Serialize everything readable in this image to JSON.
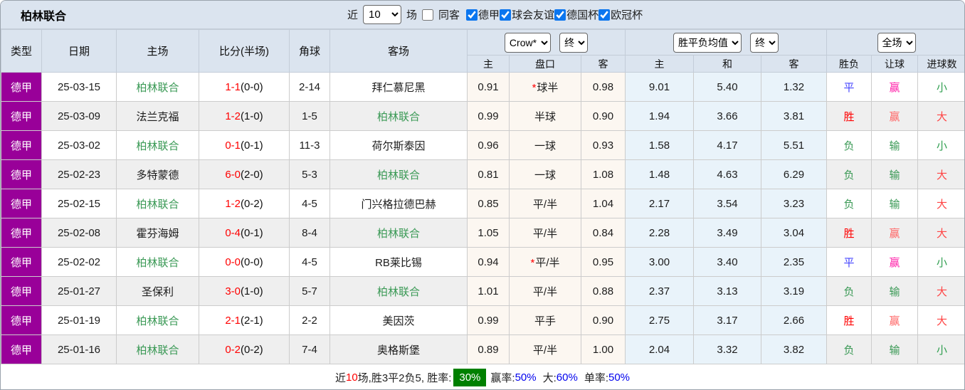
{
  "page": {
    "title": "柏林联合"
  },
  "colors": {
    "header_bg": "#dbe4ef",
    "row_alt_bg": "#efefef",
    "odds_bg": "#fcf7f1",
    "avg_bg": "#e9f3fa",
    "league_badge_bg": "#990099",
    "team_highlight": "#3a9955",
    "score_red": "#ff0000",
    "win": "#ff0000",
    "draw": "#4444ff",
    "lose": "#3a9955",
    "handicap_win": "#ff6666",
    "handicap_win_star": "#ff22aa",
    "handicap_lose": "#3a9955",
    "goals_big": "#ff4444",
    "goals_small": "#2f9e4f",
    "rate_badge_bg": "#008000",
    "percent_blue": "#0000ee",
    "count_red": "#ff0000"
  },
  "controls": {
    "recent_label": "近",
    "games_count": "10",
    "games_label": "场",
    "same_opponent": {
      "label": "同客",
      "checked": false
    },
    "leagues": [
      {
        "label": "德甲",
        "checked": true
      },
      {
        "label": "球会友谊",
        "checked": true
      },
      {
        "label": "德国杯",
        "checked": true
      },
      {
        "label": "欧冠杯",
        "checked": true
      }
    ]
  },
  "table": {
    "selectors": {
      "bookmaker": "Crow*",
      "bookmaker_state": "终",
      "avg_type": "胜平负均值",
      "avg_state": "终",
      "period": "全场"
    },
    "columns": {
      "type": "类型",
      "date": "日期",
      "home": "主场",
      "score": "比分(半场)",
      "corners": "角球",
      "away": "客场",
      "odds_home": "主",
      "odds_line": "盘口",
      "odds_away": "客",
      "avg_home": "主",
      "avg_draw": "和",
      "avg_away": "客",
      "result": "胜负",
      "handicap": "让球",
      "goals": "进球数"
    },
    "rows": [
      {
        "type": "德甲",
        "date": "25-03-15",
        "home": "柏林联合",
        "home_highlight": true,
        "score": "1-1",
        "half": "(0-0)",
        "corners": "2-14",
        "away": "拜仁慕尼黑",
        "away_highlight": false,
        "odds_home": "0.91",
        "line": "球半",
        "line_star": true,
        "odds_away": "0.98",
        "avg_home": "9.01",
        "avg_draw": "5.40",
        "avg_away": "1.32",
        "result": "平",
        "handicap": "赢",
        "goals": "小"
      },
      {
        "type": "德甲",
        "date": "25-03-09",
        "home": "法兰克福",
        "home_highlight": false,
        "score": "1-2",
        "half": "(1-0)",
        "corners": "1-5",
        "away": "柏林联合",
        "away_highlight": true,
        "odds_home": "0.99",
        "line": "半球",
        "line_star": false,
        "odds_away": "0.90",
        "avg_home": "1.94",
        "avg_draw": "3.66",
        "avg_away": "3.81",
        "result": "胜",
        "handicap": "赢",
        "goals": "大"
      },
      {
        "type": "德甲",
        "date": "25-03-02",
        "home": "柏林联合",
        "home_highlight": true,
        "score": "0-1",
        "half": "(0-1)",
        "corners": "11-3",
        "away": "荷尔斯泰因",
        "away_highlight": false,
        "odds_home": "0.96",
        "line": "一球",
        "line_star": false,
        "odds_away": "0.93",
        "avg_home": "1.58",
        "avg_draw": "4.17",
        "avg_away": "5.51",
        "result": "负",
        "handicap": "输",
        "goals": "小"
      },
      {
        "type": "德甲",
        "date": "25-02-23",
        "home": "多特蒙德",
        "home_highlight": false,
        "score": "6-0",
        "half": "(2-0)",
        "corners": "5-3",
        "away": "柏林联合",
        "away_highlight": true,
        "odds_home": "0.81",
        "line": "一球",
        "line_star": false,
        "odds_away": "1.08",
        "avg_home": "1.48",
        "avg_draw": "4.63",
        "avg_away": "6.29",
        "result": "负",
        "handicap": "输",
        "goals": "大"
      },
      {
        "type": "德甲",
        "date": "25-02-15",
        "home": "柏林联合",
        "home_highlight": true,
        "score": "1-2",
        "half": "(0-2)",
        "corners": "4-5",
        "away": "门兴格拉德巴赫",
        "away_highlight": false,
        "odds_home": "0.85",
        "line": "平/半",
        "line_star": false,
        "odds_away": "1.04",
        "avg_home": "2.17",
        "avg_draw": "3.54",
        "avg_away": "3.23",
        "result": "负",
        "handicap": "输",
        "goals": "大"
      },
      {
        "type": "德甲",
        "date": "25-02-08",
        "home": "霍芬海姆",
        "home_highlight": false,
        "score": "0-4",
        "half": "(0-1)",
        "corners": "8-4",
        "away": "柏林联合",
        "away_highlight": true,
        "odds_home": "1.05",
        "line": "平/半",
        "line_star": false,
        "odds_away": "0.84",
        "avg_home": "2.28",
        "avg_draw": "3.49",
        "avg_away": "3.04",
        "result": "胜",
        "handicap": "赢",
        "goals": "大"
      },
      {
        "type": "德甲",
        "date": "25-02-02",
        "home": "柏林联合",
        "home_highlight": true,
        "score": "0-0",
        "half": "(0-0)",
        "corners": "4-5",
        "away": "RB莱比锡",
        "away_highlight": false,
        "odds_home": "0.94",
        "line": "平/半",
        "line_star": true,
        "odds_away": "0.95",
        "avg_home": "3.00",
        "avg_draw": "3.40",
        "avg_away": "2.35",
        "result": "平",
        "handicap": "赢",
        "goals": "小"
      },
      {
        "type": "德甲",
        "date": "25-01-27",
        "home": "圣保利",
        "home_highlight": false,
        "score": "3-0",
        "half": "(1-0)",
        "corners": "5-7",
        "away": "柏林联合",
        "away_highlight": true,
        "odds_home": "1.01",
        "line": "平/半",
        "line_star": false,
        "odds_away": "0.88",
        "avg_home": "2.37",
        "avg_draw": "3.13",
        "avg_away": "3.19",
        "result": "负",
        "handicap": "输",
        "goals": "大"
      },
      {
        "type": "德甲",
        "date": "25-01-19",
        "home": "柏林联合",
        "home_highlight": true,
        "score": "2-1",
        "half": "(2-1)",
        "corners": "2-2",
        "away": "美因茨",
        "away_highlight": false,
        "odds_home": "0.99",
        "line": "平手",
        "line_star": false,
        "odds_away": "0.90",
        "avg_home": "2.75",
        "avg_draw": "3.17",
        "avg_away": "2.66",
        "result": "胜",
        "handicap": "赢",
        "goals": "大"
      },
      {
        "type": "德甲",
        "date": "25-01-16",
        "home": "柏林联合",
        "home_highlight": true,
        "score": "0-2",
        "half": "(0-2)",
        "corners": "7-4",
        "away": "奥格斯堡",
        "away_highlight": false,
        "odds_home": "0.89",
        "line": "平/半",
        "line_star": false,
        "odds_away": "1.00",
        "avg_home": "2.04",
        "avg_draw": "3.32",
        "avg_away": "3.82",
        "result": "负",
        "handicap": "输",
        "goals": "小"
      }
    ]
  },
  "footer": {
    "prefix": "近",
    "count": "10",
    "record": "场,胜3平2负5, 胜率:",
    "win_rate": "30%",
    "handicap_label": "赢率:",
    "handicap_rate": "50%",
    "big_label": "大:",
    "big_rate": "60%",
    "single_label": "单率:",
    "single_rate": "50%"
  }
}
